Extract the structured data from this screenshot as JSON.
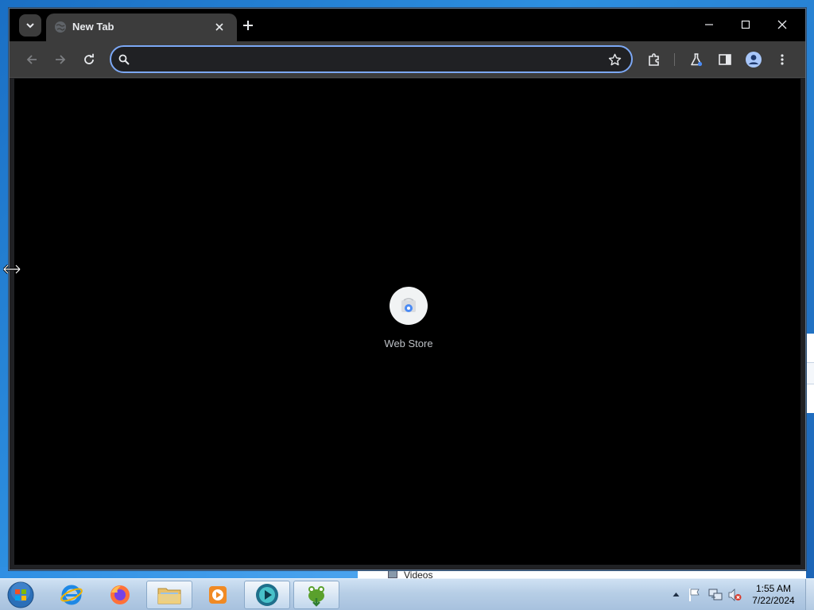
{
  "browser": {
    "tab_title": "New Tab",
    "omnibox_value": "",
    "omnibox_placeholder": ""
  },
  "new_tab_page": {
    "shortcuts": [
      {
        "label": "Web Store"
      }
    ]
  },
  "background": {
    "explorer_item": "Videos"
  },
  "taskbar": {
    "time": "1:55 AM",
    "date": "7/22/2024",
    "apps": [
      "internet-explorer",
      "firefox",
      "file-explorer",
      "media-player",
      "chrome-canary",
      "frogger"
    ]
  },
  "colors": {
    "omnibox_focus": "#7ca8f5",
    "toolbar": "#3c3c3c",
    "tabstrip": "#000000",
    "content": "#000000"
  }
}
